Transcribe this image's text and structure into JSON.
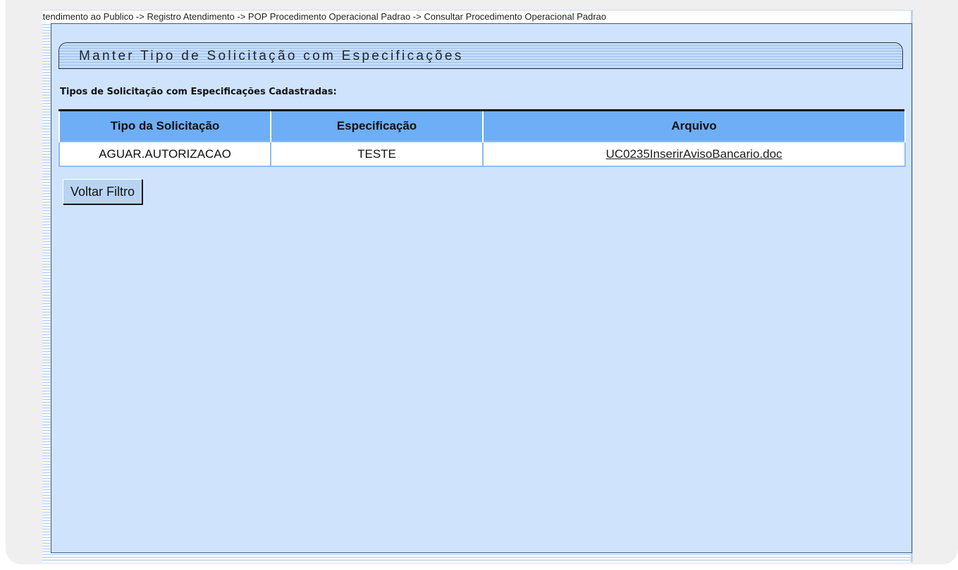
{
  "breadcrumb": "Atendimento ao Publico -> Registro Atendimento -> POP Procedimento Operacional Padrao -> Consultar Procedimento Operacional Padrao",
  "page": {
    "title": "Manter Tipo de Solicitação com Especificações",
    "subtitle": "Tipos de Solicitação com Especificações Cadastradas:"
  },
  "table": {
    "headers": [
      "Tipo da Solicitação",
      "Especificação",
      "Arquivo"
    ],
    "rows": [
      {
        "tipo": "AGUAR.AUTORIZACAO",
        "especificacao": "TESTE",
        "arquivo": "UC0235InserirAvisoBancario.doc"
      }
    ]
  },
  "buttons": {
    "voltar_filtro": "Voltar Filtro"
  },
  "colors": {
    "header_bg": "#6eaef7",
    "content_bg": "#cfe4fc"
  }
}
